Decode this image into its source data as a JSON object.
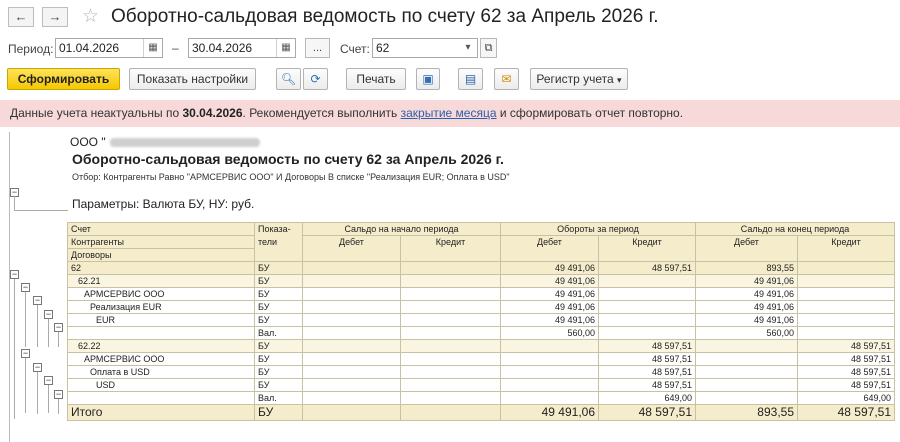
{
  "window": {
    "title": "Оборотно-сальдовая ведомость по счету 62 за Апрель 2026 г."
  },
  "nav": {
    "back_icon": "arrow-left-icon",
    "forward_icon": "arrow-right-icon",
    "favorite_icon": "star-icon"
  },
  "period": {
    "label": "Период:",
    "from": "01.04.2026",
    "dash": "–",
    "to": "30.04.2026",
    "more": "...",
    "account_label": "Счет:",
    "account": "62"
  },
  "toolbar": {
    "generate": "Сформировать",
    "settings": "Показать настройки",
    "print": "Печать",
    "register": "Регистр учета"
  },
  "warning": {
    "prefix": "Данные учета неактуальны по ",
    "date": "30.04.2026",
    "middle": ". Рекомендуется выполнить ",
    "link": "закрытие месяца",
    "suffix": " и сформировать отчет повторно."
  },
  "report": {
    "org": "ООО \"",
    "title": "Оборотно-сальдовая ведомость по счету 62 за Апрель 2026 г.",
    "filter": "Отбор: Контрагенты Равно \"АРМСЕРВИС ООО\" И Договоры В списке \"Реализация EUR; Оплата в USD\"",
    "params": "Параметры:    Валюта БУ, НУ: руб.",
    "headers": {
      "account": "Счет",
      "counterparties": "Контрагенты",
      "contracts": "Договоры",
      "indicators": "Показа-\nтели",
      "opening": "Сальдо на начало периода",
      "turnover": "Обороты за период",
      "closing": "Сальдо на конец периода",
      "debit": "Дебет",
      "credit": "Кредит"
    },
    "rows": [
      {
        "name": "62",
        "ind": "БУ",
        "od": "",
        "oc": "",
        "td": "49 491,06",
        "tc": "48 597,51",
        "cd": "893,55",
        "cc": "",
        "lvl": "r0"
      },
      {
        "name": "62.21",
        "ind": "БУ",
        "od": "",
        "oc": "",
        "td": "49 491,06",
        "tc": "",
        "cd": "49 491,06",
        "cc": "",
        "lvl": "r1"
      },
      {
        "name": "АРМСЕРВИС ООО",
        "ind": "БУ",
        "od": "",
        "oc": "",
        "td": "49 491,06",
        "tc": "",
        "cd": "49 491,06",
        "cc": "",
        "lvl": "r2"
      },
      {
        "name": "Реализация EUR",
        "ind": "БУ",
        "od": "",
        "oc": "",
        "td": "49 491,06",
        "tc": "",
        "cd": "49 491,06",
        "cc": "",
        "lvl": "r2"
      },
      {
        "name": "EUR",
        "ind": "БУ",
        "od": "",
        "oc": "",
        "td": "49 491,06",
        "tc": "",
        "cd": "49 491,06",
        "cc": "",
        "lvl": "r2"
      },
      {
        "name": "",
        "ind": "Вал.",
        "od": "",
        "oc": "",
        "td": "560,00",
        "tc": "",
        "cd": "560,00",
        "cc": "",
        "lvl": "r2"
      },
      {
        "name": "62.22",
        "ind": "БУ",
        "od": "",
        "oc": "",
        "td": "",
        "tc": "48 597,51",
        "cd": "",
        "cc": "48 597,51",
        "lvl": "r1"
      },
      {
        "name": "АРМСЕРВИС ООО",
        "ind": "БУ",
        "od": "",
        "oc": "",
        "td": "",
        "tc": "48 597,51",
        "cd": "",
        "cc": "48 597,51",
        "lvl": "r2"
      },
      {
        "name": "Оплата в USD",
        "ind": "БУ",
        "od": "",
        "oc": "",
        "td": "",
        "tc": "48 597,51",
        "cd": "",
        "cc": "48 597,51",
        "lvl": "r2"
      },
      {
        "name": "USD",
        "ind": "БУ",
        "od": "",
        "oc": "",
        "td": "",
        "tc": "48 597,51",
        "cd": "",
        "cc": "48 597,51",
        "lvl": "r2"
      },
      {
        "name": "",
        "ind": "Вал.",
        "od": "",
        "oc": "",
        "td": "",
        "tc": "649,00",
        "cd": "",
        "cc": "649,00",
        "lvl": "r2"
      }
    ],
    "total": {
      "name": "Итого",
      "ind": "БУ",
      "td": "49 491,06",
      "tc": "48 597,51",
      "cd": "893,55",
      "cc": "48 597,51"
    }
  }
}
